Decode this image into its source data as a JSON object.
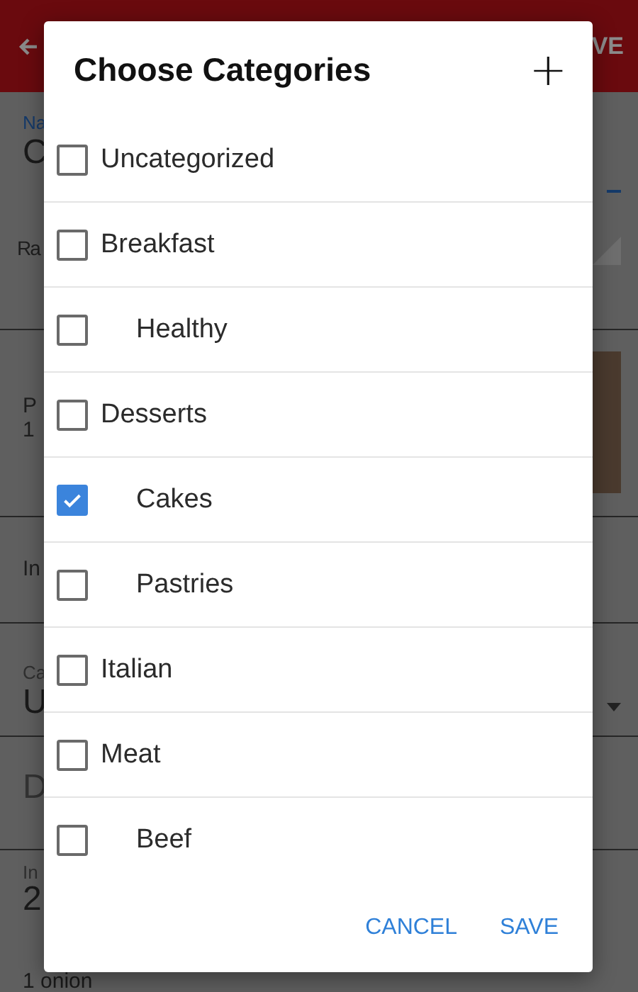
{
  "background": {
    "toolbar_action": "VE",
    "fields": [
      {
        "label": "Na",
        "value": "C"
      },
      {
        "value": "Ra"
      },
      {
        "label": "P",
        "value": "1"
      },
      {
        "value": "In"
      },
      {
        "label": "Ca",
        "value": "U"
      },
      {
        "value": "D"
      },
      {
        "label": "In",
        "value": "2"
      }
    ],
    "last_line": "1 onion"
  },
  "dialog": {
    "title": "Choose Categories",
    "add_button": "+",
    "categories": [
      {
        "label": "Uncategorized",
        "checked": false
      },
      {
        "label": "Breakfast",
        "checked": false,
        "children": [
          {
            "label": "Healthy",
            "checked": false
          }
        ]
      },
      {
        "label": "Desserts",
        "checked": false,
        "children": [
          {
            "label": "Cakes",
            "checked": true
          },
          {
            "label": "Pastries",
            "checked": false
          }
        ]
      },
      {
        "label": "Italian",
        "checked": false
      },
      {
        "label": "Meat",
        "checked": false,
        "children": [
          {
            "label": "Beef",
            "checked": false
          }
        ]
      }
    ],
    "buttons": [
      "CANCEL",
      "SAVE"
    ]
  }
}
